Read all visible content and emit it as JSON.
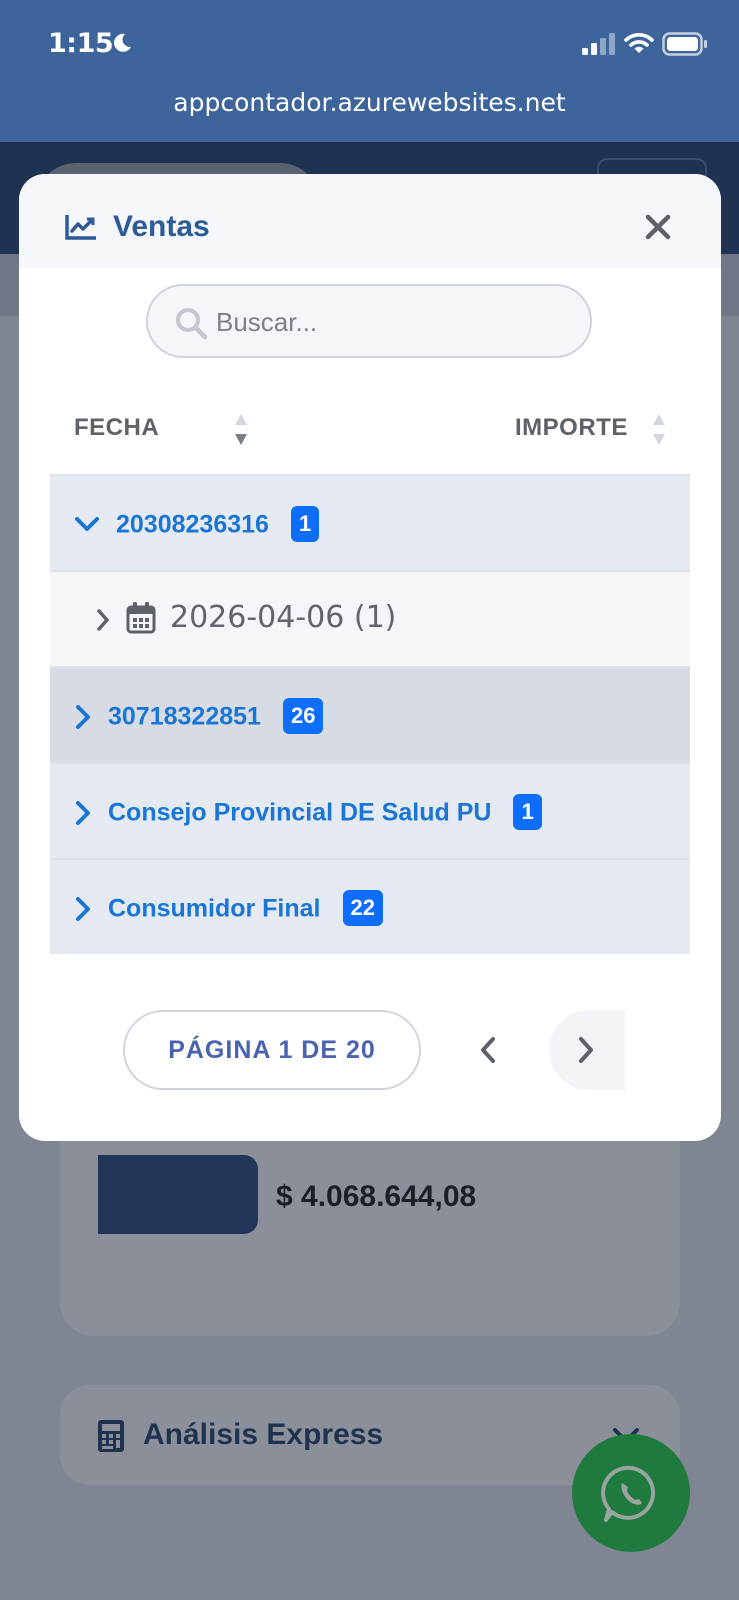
{
  "status_bar": {
    "time": "1:15"
  },
  "browser": {
    "url": "appcontador.azurewebsites.net"
  },
  "background": {
    "amount": "$ 4.068.644,08",
    "analisis_title": "Análisis Express"
  },
  "modal": {
    "title": "Ventas",
    "search": {
      "placeholder": "Buscar...",
      "value": ""
    },
    "columns": {
      "fecha": "FECHA",
      "importe": "IMPORTE"
    },
    "rows": [
      {
        "label": "20308236316",
        "count": "1",
        "expanded": true
      },
      {
        "label": "2026-04-06 (1)"
      },
      {
        "label": "30718322851",
        "count": "26"
      },
      {
        "label": "Consejo Provincial DE Salud PU",
        "count": "1"
      },
      {
        "label": "Consumidor Final",
        "count": "22"
      }
    ],
    "pagination": {
      "label": "PÁGINA 1 DE 20"
    }
  },
  "colors": {
    "accent": "#1a76d6",
    "badge": "#0d6efd",
    "topbar": "#3e659b",
    "title": "#2d5b97",
    "whatsapp": "#1f7a3e"
  },
  "icons": [
    "moon-icon",
    "signal-icon",
    "wifi-icon",
    "battery-icon",
    "chart-line-icon",
    "close-icon",
    "search-icon",
    "sort-icon",
    "chevron-down-icon",
    "chevron-right-icon",
    "calendar-icon",
    "chevron-left-icon",
    "calculator-icon",
    "whatsapp-icon"
  ]
}
